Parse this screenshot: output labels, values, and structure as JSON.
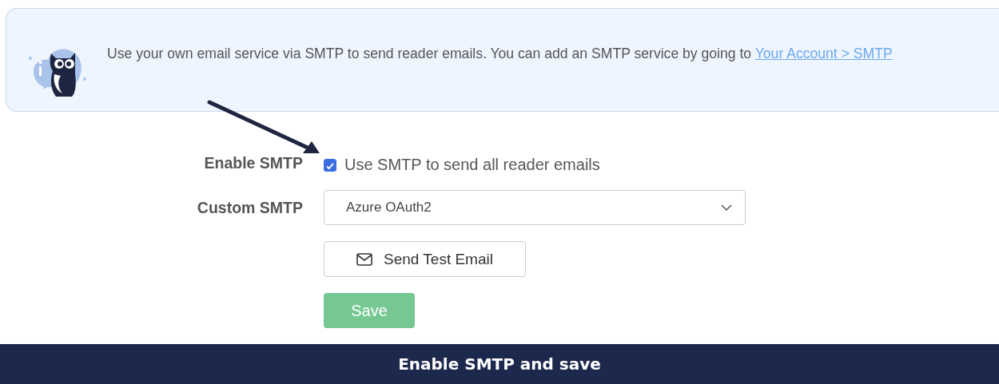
{
  "info_banner": {
    "text": "Use your own email service via SMTP to send reader emails. You can add an SMTP service by going to ",
    "link": "Your Account > SMTP"
  },
  "form": {
    "enable_smtp": {
      "label": "Enable SMTP",
      "checkbox_label": "Use SMTP to send all reader emails",
      "checked": true
    },
    "custom_smtp": {
      "label": "Custom SMTP",
      "value": "Azure OAuth2"
    },
    "test_button": "Send Test Email",
    "save_button": {
      "label": "Save",
      "disabled": true
    }
  },
  "caption": "Enable SMTP and save"
}
